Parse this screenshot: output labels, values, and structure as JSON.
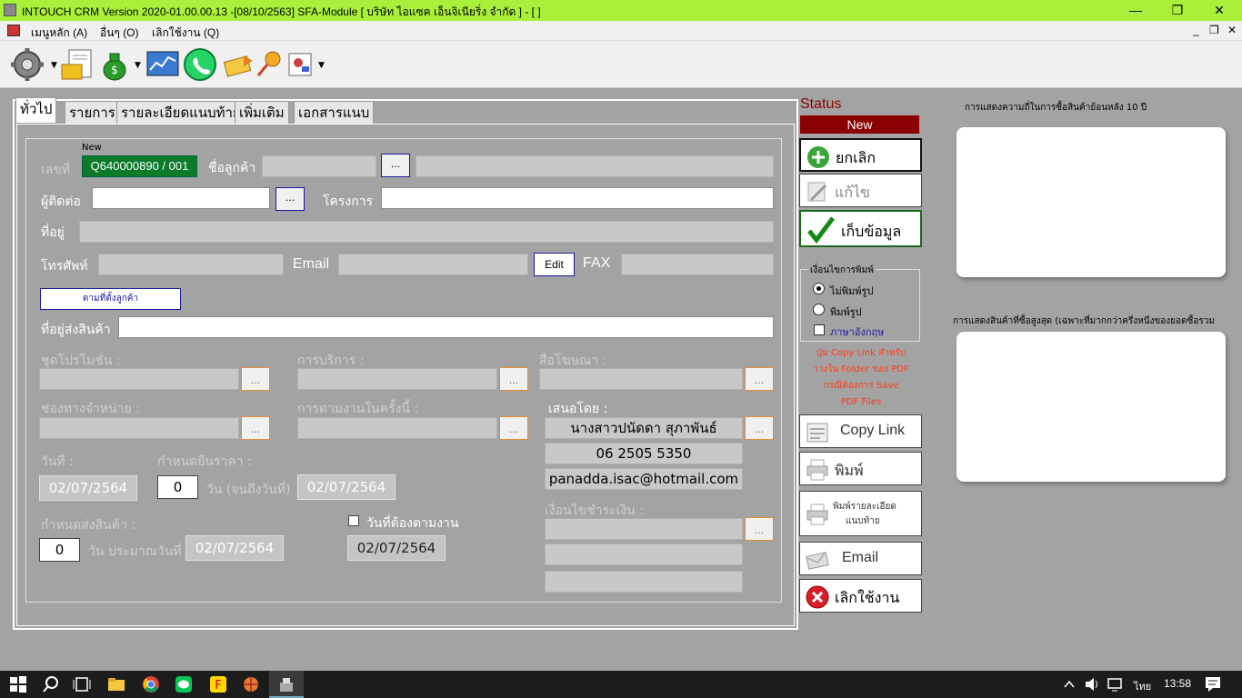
{
  "window": {
    "title": "INTOUCH CRM Version 2020-01.00.00.13 -[08/10/2563] SFA-Module  [ บริษัท ไอแซค เอ็นจิเนียริ่ง จำกัด ] - [ ]",
    "minimize": "—",
    "restore": "❐",
    "close": "✕"
  },
  "menu": {
    "items": [
      "เมนูหลัก (A)",
      "อื่นๆ (O)",
      "เลิกใช้งาน (Q)"
    ],
    "mdi_minimize": "_",
    "mdi_restore": "❐",
    "mdi_close": "✕"
  },
  "tabs": [
    "ทั่วไป",
    "รายการ",
    "รายละเอียดแนบท้าย",
    "เพิ่มเติม",
    "เอกสารแนบ"
  ],
  "form": {
    "new_badge": "New",
    "doc_no_label": "เลขที่",
    "doc_no_value": "Q640000890 / 001",
    "customer_label": "ชื่อลูกค้า",
    "contact_label": "ผู้ติดต่อ",
    "project_label": "โครงการ",
    "address_label": "ที่อยู่",
    "phone_label": "โทรศัพท์",
    "email_label": "Email",
    "edit_button": "Edit",
    "fax_label": "FAX",
    "per_customer_button": "ตามที่ตั้งลูกค้า",
    "ship_address_label": "ที่อยู่ส่งสินค้า",
    "promotion_label": "ชุดโปรโมชั่น :",
    "service_label": "การบริการ :",
    "media_label": "สื่อโฆษณา :",
    "channel_label": "ช่องทางจำหน่าย  :",
    "followup_label": "การตามงานในครั้งนี้ :",
    "offered_by_label": "เสนอโดย :",
    "offered_by_name": "นางสาวปนัดดา สุภาพันธ์",
    "offered_by_phone": "06 2505 5350",
    "offered_by_email": "panadda.isac@hotmail.com",
    "date_label": "วันที่ :",
    "date_value": "02/07/2564",
    "price_valid_label": "กำหนดยืนราคา :",
    "price_valid_days": "0",
    "price_valid_unit": "วัน (จนถึงวันที่)",
    "price_valid_date": "02/07/2564",
    "payment_label": "เงื่อนไขชำระเงิน :",
    "delivery_label": "กำหนดส่งสินค้า :",
    "delivery_days": "0",
    "delivery_unit": "วัน ประมาณวันที่",
    "delivery_date": "02/07/2564",
    "followup_date_label": "วันที่ต้องตามงาน",
    "followup_date": "02/07/2564",
    "dots": "...",
    "dots_small": "..."
  },
  "actions": {
    "status_label": "Status",
    "status_value": "New",
    "cancel": "ยกเลิก",
    "edit": "แก้ไข",
    "save": "เก็บข้อมูล",
    "print_conditions_title": "เงื่อนไขการพิมพ์",
    "opt_no_image": "ไม่พิมพ์รูป",
    "opt_image": "พิมพ์รูป",
    "opt_english": "ภาษาอังกฤษ",
    "copy_note": [
      "ปุ่ม Copy Link สำหรับ",
      "วางใน Folder ของ PDF",
      "กรณีต้องการ Save",
      "PDF Files"
    ],
    "copy_link": "Copy Link",
    "print": "พิมพ์",
    "print_detail": [
      "พิมพ์รายละเอียด",
      "แนบท้าย"
    ],
    "email": "Email",
    "quit": "เลิกใช้งาน"
  },
  "side_panels": {
    "freq_title": "การแสดงความถี่ในการซื้อสินค้าย้อนหลัง 10 ปี",
    "top_title": "การแสดงสินค้าที่ซื้อสูงสุด (เฉพาะที่มากกว่าครึ่งหนึ่งของยอดซื้อรวม"
  },
  "taskbar": {
    "lang": "ไทย",
    "time": "13:58"
  },
  "colors": {
    "titlebar": "#a9f03a",
    "status_bg": "#8b0000",
    "doc_no_bg": "#0b7a2a",
    "dots_border": "#e88b2c",
    "note_color": "#ff3b1a"
  }
}
